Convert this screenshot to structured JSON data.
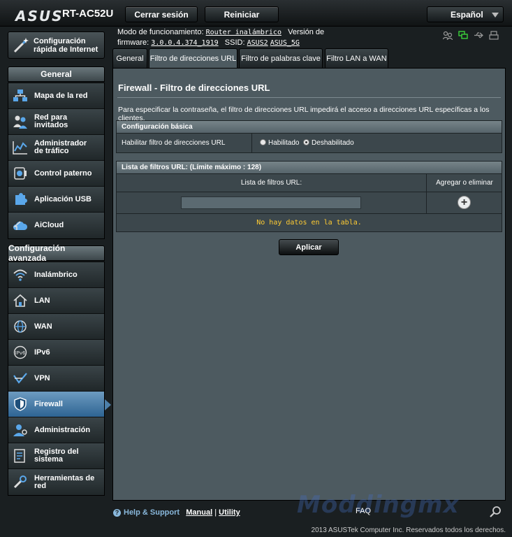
{
  "header": {
    "brand": "ASUS",
    "model": "RT-AC52U",
    "logout_label": "Cerrar sesión",
    "reboot_label": "Reiniciar",
    "language": "Español"
  },
  "info": {
    "mode_label": "Modo de funcionamiento:",
    "mode_value": "Router inalámbrico",
    "firmware_label_1": "Versión de",
    "firmware_label_2": "firmware:",
    "firmware_value": "3.0.0.4.374_1919",
    "ssid_label": "SSID:",
    "ssid_1": "ASUS2",
    "ssid_2": "ASUS_5G"
  },
  "quick_setup": {
    "label": "Configuración rápida de Internet"
  },
  "sidebar": {
    "general_header": "General",
    "general_items": [
      {
        "label": "Mapa de la red",
        "icon": "network-map-icon"
      },
      {
        "label": "Red para invitados",
        "icon": "guest-network-icon"
      },
      {
        "label": "Administrador de tráfico",
        "icon": "traffic-manager-icon"
      },
      {
        "label": "Control paterno",
        "icon": "parental-control-icon"
      },
      {
        "label": "Aplicación USB",
        "icon": "usb-app-icon"
      },
      {
        "label": "AiCloud",
        "icon": "cloud-icon"
      }
    ],
    "advanced_header": "Configuración avanzada",
    "advanced_items": [
      {
        "label": "Inalámbrico",
        "icon": "wifi-icon"
      },
      {
        "label": "LAN",
        "icon": "home-icon"
      },
      {
        "label": "WAN",
        "icon": "globe-icon"
      },
      {
        "label": "IPv6",
        "icon": "ipv6-icon"
      },
      {
        "label": "VPN",
        "icon": "vpn-icon"
      },
      {
        "label": "Firewall",
        "icon": "firewall-icon",
        "active": true
      },
      {
        "label": "Administración",
        "icon": "admin-icon"
      },
      {
        "label": "Registro del sistema",
        "icon": "system-log-icon"
      },
      {
        "label": "Herramientas de red",
        "icon": "network-tools-icon"
      }
    ]
  },
  "tabs": [
    {
      "label": "General"
    },
    {
      "label": "Filtro de direcciones URL",
      "active": true
    },
    {
      "label": "Filtro de palabras clave"
    },
    {
      "label": "Filtro LAN a WAN"
    }
  ],
  "main": {
    "title": "Firewall - Filtro de direcciones URL",
    "description": "Para especificar la contraseña, el filtro de direcciones URL impedirá el acceso a direcciones URL específicas a los clientes.",
    "basic_header": "Configuración básica",
    "enable_label": "Habilitar filtro de direcciones URL",
    "option_enabled": "Habilitado",
    "option_disabled": "Deshabilitado",
    "selected_option": "Deshabilitado",
    "list_header": "Lista de filtros URL: (Límite máximo : 128)",
    "col_list": "Lista de filtros URL:",
    "col_action": "Agregar o eliminar",
    "url_input_value": "",
    "add_symbol": "+",
    "empty_message": "No hay datos en la tabla.",
    "apply_label": "Aplicar"
  },
  "footer": {
    "help": "Help & Support",
    "manual": "Manual",
    "separator": "|",
    "utility": "Utility",
    "faq": "FAQ",
    "copyright": "2013 ASUSTek Computer Inc. Reservados todos los derechos.",
    "watermark": "Moddingmx"
  },
  "colors": {
    "accent": "#4d80aa",
    "content_bg": "#4d5a60",
    "notice": "#ffcc33",
    "status_green": "#3bd13b"
  }
}
